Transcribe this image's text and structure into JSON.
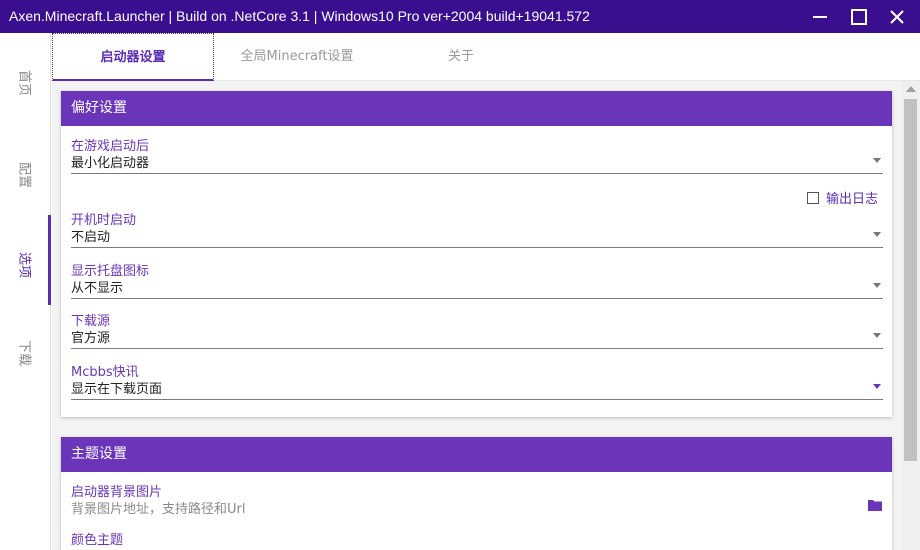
{
  "window": {
    "title": "Axen.Minecraft.Launcher | Build on .NetCore 3.1 | Windows10 Pro ver+2004 build+19041.572",
    "title_color": "#3a0f8f"
  },
  "sidebar": {
    "items": [
      {
        "label": "首页",
        "active": false
      },
      {
        "label": "配置",
        "active": false
      },
      {
        "label": "选项",
        "active": true
      },
      {
        "label": "下载",
        "active": false
      }
    ]
  },
  "tabs": [
    {
      "label": "启动器设置",
      "active": true
    },
    {
      "label": "全局Minecraft设置",
      "active": false
    },
    {
      "label": "关于",
      "active": false
    }
  ],
  "preferences": {
    "header": "偏好设置",
    "after_launch": {
      "label": "在游戏启动后",
      "value": "最小化启动器"
    },
    "output_log": {
      "label": "输出日志",
      "checked": false
    },
    "startup": {
      "label": "开机时启动",
      "value": "不启动"
    },
    "tray_icon": {
      "label": "显示托盘图标",
      "value": "从不显示"
    },
    "download_source": {
      "label": "下载源",
      "value": "官方源"
    },
    "mcbbs_news": {
      "label": "Mcbbs快讯",
      "value": "显示在下载页面"
    }
  },
  "theme": {
    "header": "主题设置",
    "background_image": {
      "label": "启动器背景图片",
      "placeholder": "背景图片地址，支持路径和Url"
    },
    "color_theme": {
      "label": "颜色主题"
    }
  },
  "colors": {
    "accent": "#6a35b8",
    "titlebar": "#3a0f8f"
  }
}
